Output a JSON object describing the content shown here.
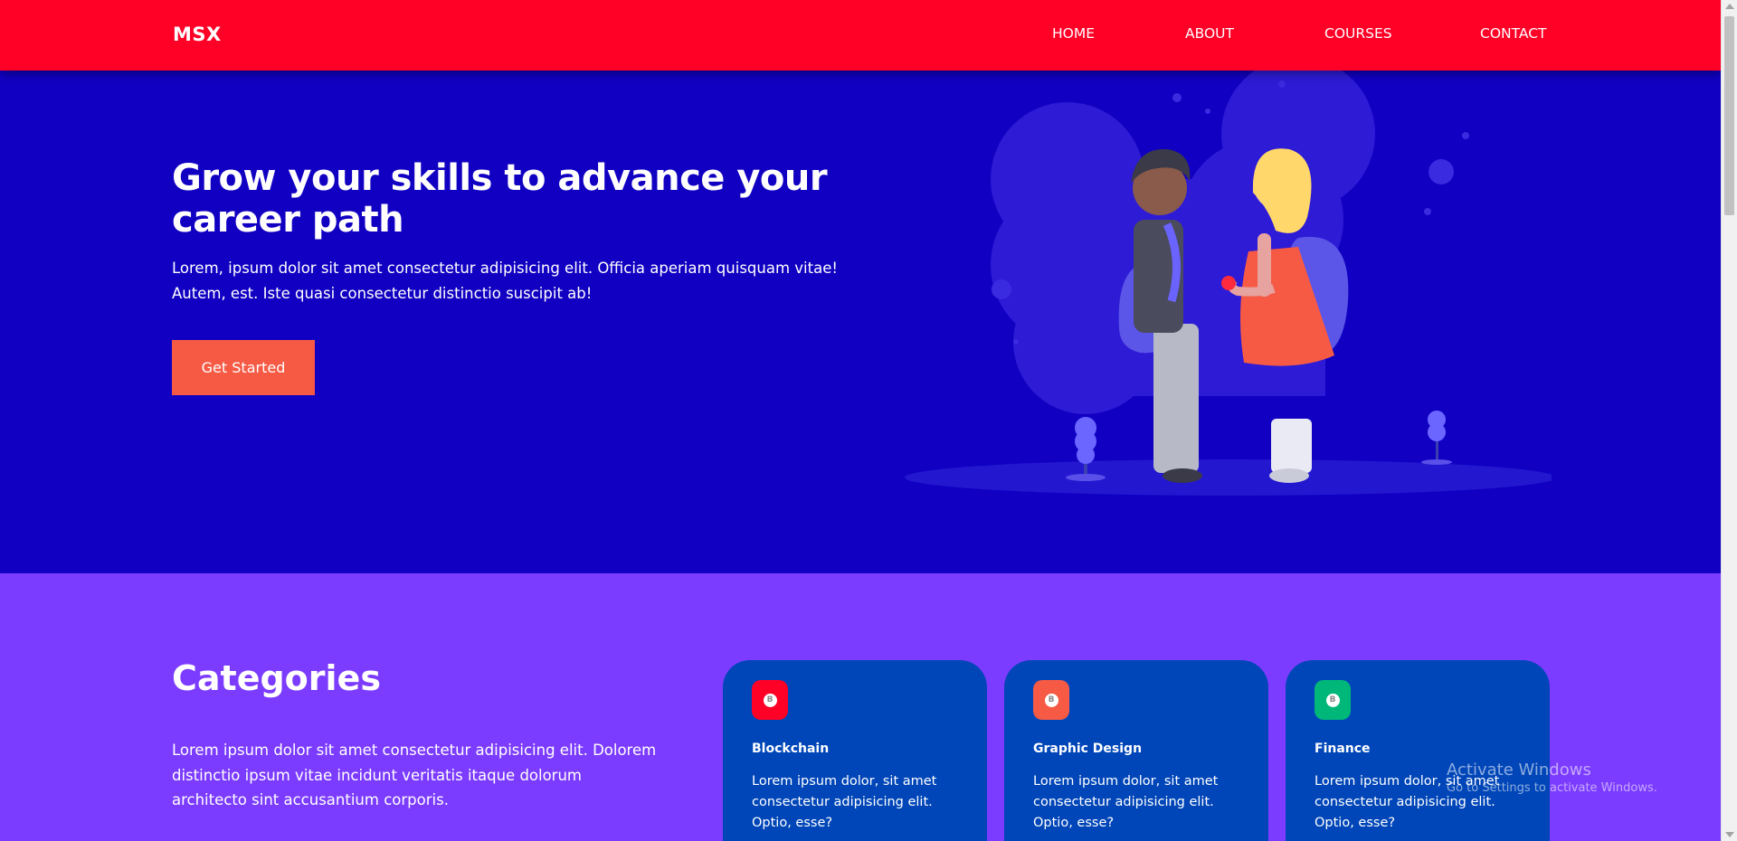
{
  "nav": {
    "logo": "MSX",
    "links": [
      "HOME",
      "ABOUT",
      "COURSES",
      "CONTACT"
    ]
  },
  "hero": {
    "title": "Grow your skills to advance your career path",
    "text": "Lorem, ipsum dolor sit amet consectetur adipisicing elit. Officia aperiam quisquam vitae! Autem, est. Iste quasi consectetur distinctio suscipit ab!",
    "cta_label": "Get Started"
  },
  "categories": {
    "title": "Categories",
    "text": "Lorem ipsum dolor sit amet consectetur adipisicing elit. Dolorem distinctio ipsum vitae incidunt veritatis itaque dolorum architecto sint accusantium corporis.",
    "cards": [
      {
        "title": "Blockchain",
        "text": "Lorem ipsum dolor, sit amet consectetur adipisicing elit. Optio, esse?",
        "icon": "bitcoin-icon",
        "color": "#ff0026"
      },
      {
        "title": "Graphic Design",
        "text": "Lorem ipsum dolor, sit amet consectetur adipisicing elit. Optio, esse?",
        "icon": "bitcoin-icon",
        "color": "#f65a44"
      },
      {
        "title": "Finance",
        "text": "Lorem ipsum dolor, sit amet consectetur adipisicing elit. Optio, esse?",
        "icon": "bitcoin-icon",
        "color": "#00b77a"
      }
    ]
  },
  "watermark": {
    "title": "Activate Windows",
    "subtitle": "Go to Settings to activate Windows."
  },
  "colors": {
    "nav_bg": "#ff0026",
    "hero_bg": "#1100c2",
    "categories_bg": "#7c3cff",
    "card_bg": "#0046b8",
    "cta_bg": "#f65a44"
  }
}
